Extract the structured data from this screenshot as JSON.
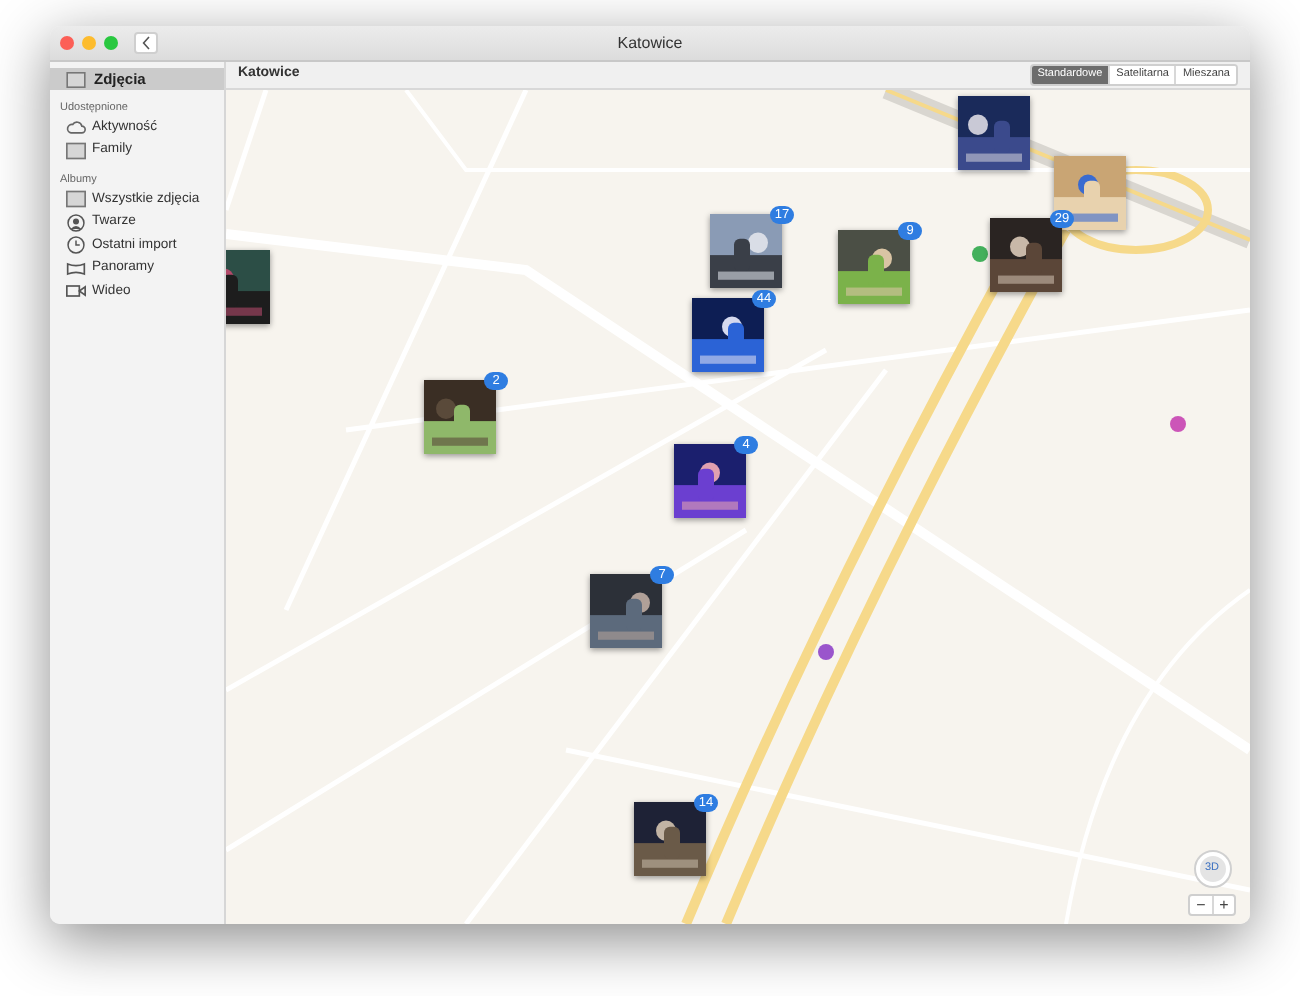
{
  "window": {
    "title": "Katowice"
  },
  "sidebar": {
    "top": [
      {
        "label": "Zdjęcia",
        "selected": true
      }
    ],
    "sections": [
      {
        "title": "Udostępnione",
        "items": [
          {
            "label": "Aktywność",
            "selected": false
          },
          {
            "label": "Family",
            "selected": false
          }
        ]
      },
      {
        "title": "Albumy",
        "items": [
          {
            "label": "Wszystkie zdjęcia",
            "selected": false
          },
          {
            "label": "Twarze",
            "selected": false
          },
          {
            "label": "Ostatni import",
            "selected": false
          },
          {
            "label": "Panoramy",
            "selected": false
          },
          {
            "label": "Wideo",
            "selected": false
          }
        ]
      }
    ]
  },
  "toolbar": {
    "place": "Katowice",
    "map_modes": [
      {
        "label": "Standardowe",
        "selected": true
      },
      {
        "label": "Satelitarna",
        "selected": false
      },
      {
        "label": "Mieszana",
        "selected": false
      }
    ]
  },
  "map": {
    "kind": "picture",
    "photo_pins": [
      {
        "kind": "picture"
      },
      {
        "kind": "picture"
      },
      {
        "kind": "picture",
        "count": "17"
      },
      {
        "kind": "picture",
        "count": "29"
      },
      {
        "kind": "picture",
        "count": "9"
      },
      {
        "kind": "picture"
      },
      {
        "kind": "picture",
        "count": "44"
      },
      {
        "kind": "picture",
        "count": "2"
      },
      {
        "kind": "picture",
        "count": "4"
      },
      {
        "kind": "picture",
        "count": "7"
      },
      {
        "kind": "picture",
        "count": "14"
      }
    ],
    "compass": {
      "label": "3D"
    },
    "zoom_out": {
      "label": "−"
    },
    "zoom_in": {
      "label": "+"
    }
  }
}
